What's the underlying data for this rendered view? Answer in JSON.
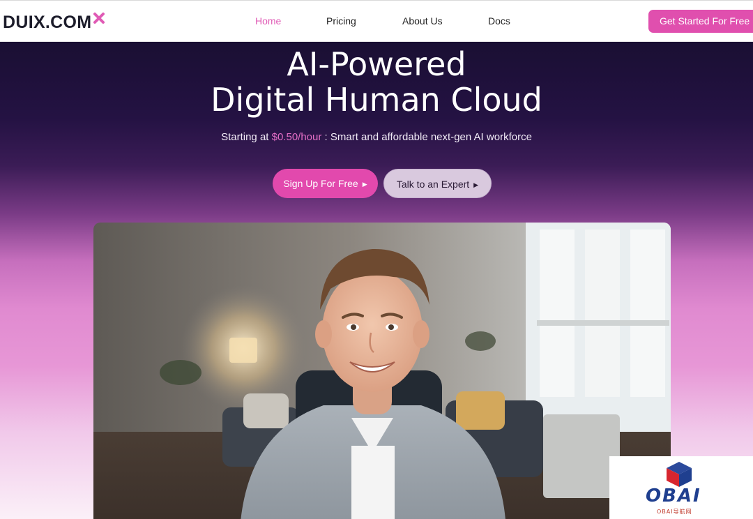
{
  "brand": {
    "logo_text": "DUIX.COM",
    "accent": "#e04fae",
    "logo_x_color": "#e05bb5"
  },
  "nav": {
    "items": [
      {
        "label": "Home",
        "active": true
      },
      {
        "label": "Pricing",
        "active": false
      },
      {
        "label": "About Us",
        "active": false
      },
      {
        "label": "Docs",
        "active": false
      }
    ],
    "cta_label": "Get Started For Free"
  },
  "hero": {
    "title_line1": "AI-Powered",
    "title_line2": "Digital Human Cloud",
    "subtitle_prefix": "Starting at ",
    "subtitle_price": "$0.50/hour",
    "subtitle_suffix": " : Smart and affordable next-gen AI workforce",
    "primary_button": "Sign Up For Free",
    "secondary_button": "Talk to an Expert",
    "button_arrow_icon": "play-triangle-icon",
    "colors": {
      "primary_button": "#e249ad",
      "price_text": "#e46fc6"
    }
  },
  "watermark": {
    "text": "OBAI",
    "subtext": "OBAI导航网"
  }
}
